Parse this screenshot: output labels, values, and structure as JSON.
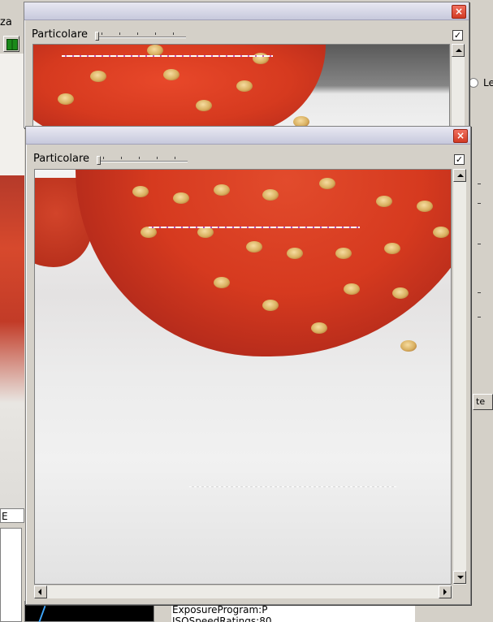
{
  "background_app": {
    "title_fragment": "za",
    "left_label": "E",
    "radio_label": "Le",
    "right_button_label": "te",
    "info_lines": [
      "ExposureProgram:P",
      "ISOSpeedRatings:80"
    ]
  },
  "window_back": {
    "toolbar_label": "Particolare",
    "close_glyph": "×",
    "check_glyph": "✓",
    "checked": true
  },
  "window_front": {
    "toolbar_label": "Particolare",
    "close_glyph": "×",
    "check_glyph": "✓",
    "checked": true
  },
  "colors": {
    "strawberry_red": "#d63a1f",
    "strawberry_dark": "#a8261a",
    "surface": "#e9e9e9",
    "title_bar": "#c7c9dc",
    "close_red": "#d23a24"
  },
  "icons": [
    "close-icon",
    "checkbox-icon",
    "scroll-up-icon",
    "scroll-down-icon",
    "scroll-left-icon",
    "scroll-right-icon",
    "grid-icon"
  ]
}
